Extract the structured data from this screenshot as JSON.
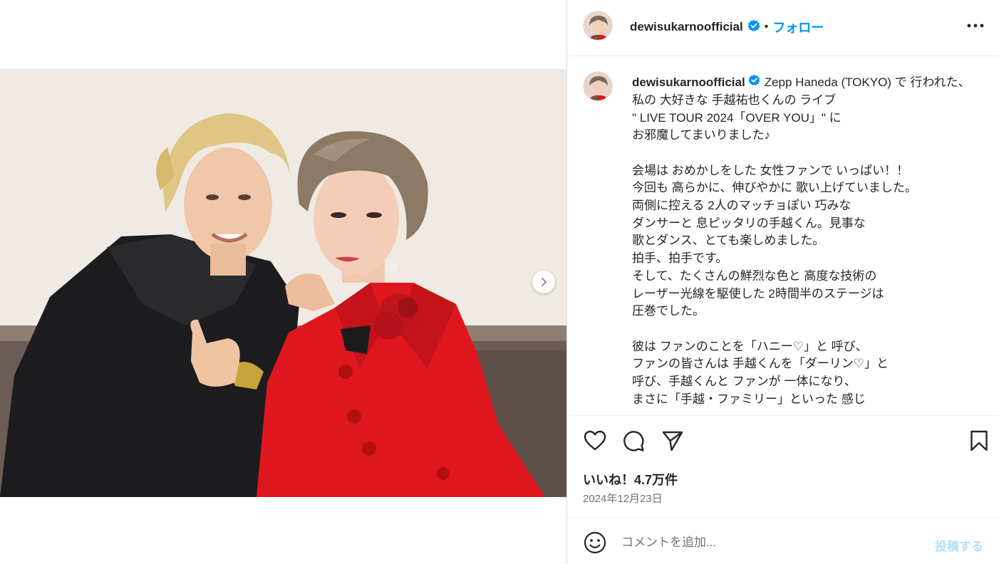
{
  "post": {
    "username": "dewisukarnoofficial",
    "separator": "•",
    "follow_label": "フォロー",
    "caption_user": "dewisukarnoofficial",
    "caption_text": "Zepp Haneda (TOKYO) で 行われた、\n私の 大好きな 手越祐也くんの ライブ\n\" LIVE TOUR 2024「OVER YOU」\" に\nお邪魔してまいりました♪\n\n会場は おめかしをした 女性ファンで いっぱい！！\n今回も 高らかに、伸びやかに 歌い上げていました。\n両側に控える 2人のマッチョぽい 巧みな\nダンサーと 息ピッタリの手越くん。見事な\n歌とダンス、とても楽しめました。\n拍手、拍手です。\nそして、たくさんの鮮烈な色と 高度な技術の\nレーザー光線を駆使した 2時間半のステージは\n圧巻でした。\n\n彼は ファンのことを「ハニー♡」と 呼び、\nファンの皆さんは 手越くんを「ダーリン♡」と\n呼び、手越くんと ファンが 一体になり、\nまさに「手越・ファミリー」といった 感じ",
    "likes": "いいね！4.7万件",
    "date": "2024年12月23日"
  },
  "comment": {
    "placeholder": "コメントを追加...",
    "post_label": "投稿する"
  },
  "icons": {
    "verified": "verified-badge-icon",
    "more": "more-options-icon",
    "like": "heart-icon",
    "comment": "comment-bubble-icon",
    "share": "paper-plane-icon",
    "save": "bookmark-icon",
    "emoji": "smiley-icon",
    "next": "chevron-right-icon"
  },
  "colors": {
    "accent": "#0095f6",
    "verified": "#0095f6",
    "post_disabled": "#b2dffc",
    "text": "#262626",
    "muted": "#737373"
  }
}
